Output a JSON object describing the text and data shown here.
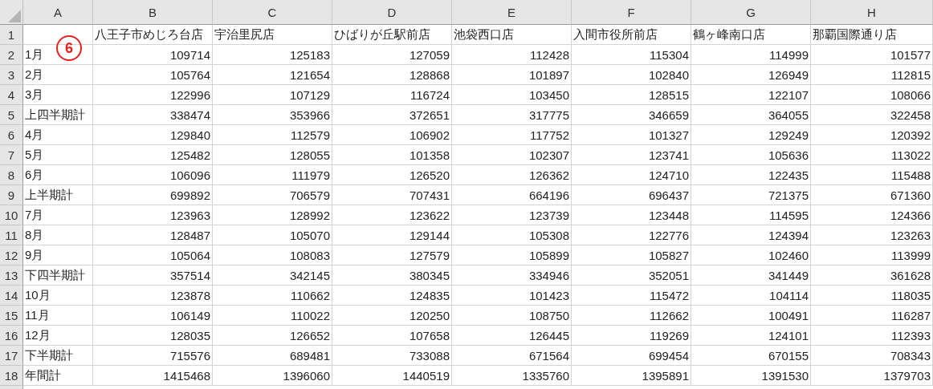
{
  "columns": [
    "A",
    "B",
    "C",
    "D",
    "E",
    "F",
    "G",
    "H"
  ],
  "header_row": {
    "number": "1",
    "stores": [
      "八王子市めじろ台店",
      "宇治里尻店",
      "ひばりが丘駅前店",
      "池袋西口店",
      "入間市役所前店",
      "鶴ヶ峰南口店",
      "那覇国際通り店"
    ]
  },
  "annotation": {
    "label": "6"
  },
  "rows": [
    {
      "number": "2",
      "label": "1月",
      "values": [
        "109714",
        "125183",
        "127059",
        "112428",
        "115304",
        "114999",
        "101577"
      ]
    },
    {
      "number": "3",
      "label": "2月",
      "values": [
        "105764",
        "121654",
        "128868",
        "101897",
        "102840",
        "126949",
        "112815"
      ]
    },
    {
      "number": "4",
      "label": "3月",
      "values": [
        "122996",
        "107129",
        "116724",
        "103450",
        "128515",
        "122107",
        "108066"
      ]
    },
    {
      "number": "5",
      "label": "上四半期計",
      "values": [
        "338474",
        "353966",
        "372651",
        "317775",
        "346659",
        "364055",
        "322458"
      ]
    },
    {
      "number": "6",
      "label": "4月",
      "values": [
        "129840",
        "112579",
        "106902",
        "117752",
        "101327",
        "129249",
        "120392"
      ]
    },
    {
      "number": "7",
      "label": "5月",
      "values": [
        "125482",
        "128055",
        "101358",
        "102307",
        "123741",
        "105636",
        "113022"
      ]
    },
    {
      "number": "8",
      "label": "6月",
      "values": [
        "106096",
        "111979",
        "126520",
        "126362",
        "124710",
        "122435",
        "115488"
      ]
    },
    {
      "number": "9",
      "label": "上半期計",
      "values": [
        "699892",
        "706579",
        "707431",
        "664196",
        "696437",
        "721375",
        "671360"
      ]
    },
    {
      "number": "10",
      "label": "7月",
      "values": [
        "123963",
        "128992",
        "123622",
        "123739",
        "123448",
        "114595",
        "124366"
      ]
    },
    {
      "number": "11",
      "label": "8月",
      "values": [
        "128487",
        "105070",
        "129144",
        "105308",
        "122776",
        "124394",
        "123263"
      ]
    },
    {
      "number": "12",
      "label": "9月",
      "values": [
        "105064",
        "108083",
        "127579",
        "105899",
        "105827",
        "102460",
        "113999"
      ]
    },
    {
      "number": "13",
      "label": "下四半期計",
      "values": [
        "357514",
        "342145",
        "380345",
        "334946",
        "352051",
        "341449",
        "361628"
      ]
    },
    {
      "number": "14",
      "label": "10月",
      "values": [
        "123878",
        "110662",
        "124835",
        "101423",
        "115472",
        "104114",
        "118035"
      ]
    },
    {
      "number": "15",
      "label": "11月",
      "values": [
        "106149",
        "110022",
        "120250",
        "108750",
        "112662",
        "100491",
        "116287"
      ]
    },
    {
      "number": "16",
      "label": "12月",
      "values": [
        "128035",
        "126652",
        "107658",
        "126445",
        "119269",
        "124101",
        "112393"
      ]
    },
    {
      "number": "17",
      "label": "下半期計",
      "values": [
        "715576",
        "689481",
        "733088",
        "671564",
        "699454",
        "670155",
        "708343"
      ]
    },
    {
      "number": "18",
      "label": "年間計",
      "values": [
        "1415468",
        "1396060",
        "1440519",
        "1335760",
        "1395891",
        "1391530",
        "1379703"
      ]
    }
  ]
}
